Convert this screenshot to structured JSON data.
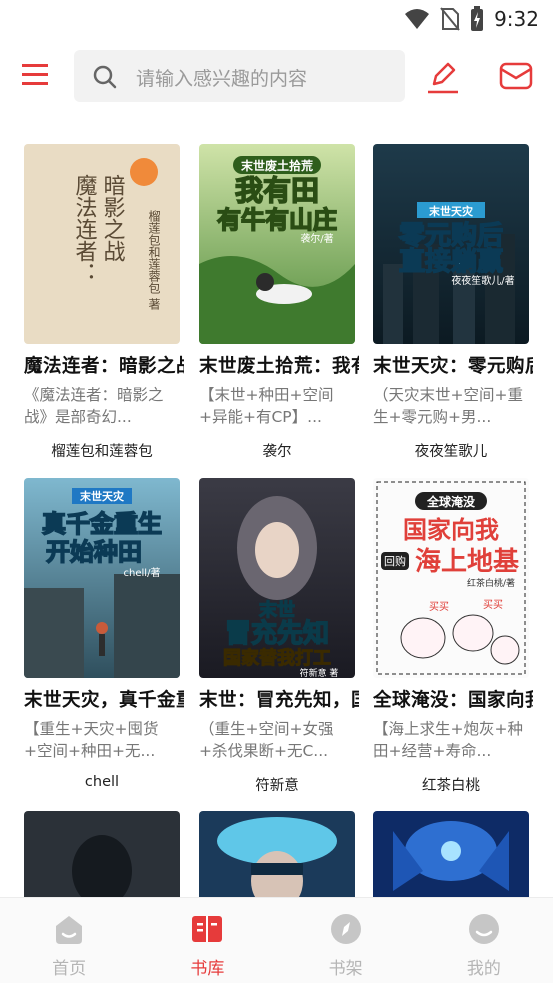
{
  "status": {
    "time": "9:32"
  },
  "search": {
    "placeholder": "请输入感兴趣的内容"
  },
  "colors": {
    "accent": "#e63b3b",
    "inactive": "#c6c6c6"
  },
  "books": [
    {
      "title": "魔法连者：暗影之战",
      "desc": "《魔法连者：暗影之战》是部奇幻...",
      "author": "榴莲包和莲蓉包",
      "cover_text": [
        "暗影之战",
        "魔法连者：",
        "榴莲包和莲蓉包 著"
      ]
    },
    {
      "title": "末世废土拾荒：我有田有牛有山庄",
      "desc": "【末世+种田+空间+异能+有CP】...",
      "author": "袭尔",
      "cover_text": [
        "末世废土拾荒",
        "我有田",
        "有牛有山庄",
        "袭尔/著"
      ]
    },
    {
      "title": "末世天灾：零元购后直接躺赢",
      "desc": "（天灾末世+空间+重生+零元购+男...",
      "author": "夜夜笙歌儿",
      "cover_text": [
        "末世天灾",
        "零元购后",
        "直接躺赢",
        "夜夜笙歌儿/著"
      ]
    },
    {
      "title": "末世天灾，真千金重生开始种田",
      "desc": "【重生+天灾+囤货+空间+种田+无...",
      "author": "chell",
      "cover_text": [
        "末世天灾",
        "真千金重生",
        "开始种田",
        "chell/著"
      ]
    },
    {
      "title": "末世：冒充先知，国家替我打工",
      "desc": "（重生+空间+女强+杀伐果断+无C...",
      "author": "符新意",
      "cover_text": [
        "末世",
        "冒充先知",
        "国家替我打工",
        "符新意 著"
      ]
    },
    {
      "title": "全球淹没：国家向我回购海上地基",
      "desc": "【海上求生+炮灰+种田+经营+寿命...",
      "author": "红茶白桃",
      "cover_text": [
        "全球淹没",
        "国家向我",
        "回购",
        "海上地基",
        "红茶白桃/著",
        "买买",
        "买买"
      ]
    },
    {
      "title": "",
      "desc": "",
      "author": "",
      "cover_text": []
    },
    {
      "title": "",
      "desc": "",
      "author": "",
      "cover_text": []
    },
    {
      "title": "",
      "desc": "",
      "author": "",
      "cover_text": []
    }
  ],
  "nav": [
    {
      "label": "首页",
      "icon": "home-icon",
      "active": false
    },
    {
      "label": "书库",
      "icon": "library-icon",
      "active": true
    },
    {
      "label": "书架",
      "icon": "bookshelf-icon",
      "active": false
    },
    {
      "label": "我的",
      "icon": "profile-icon",
      "active": false
    }
  ]
}
